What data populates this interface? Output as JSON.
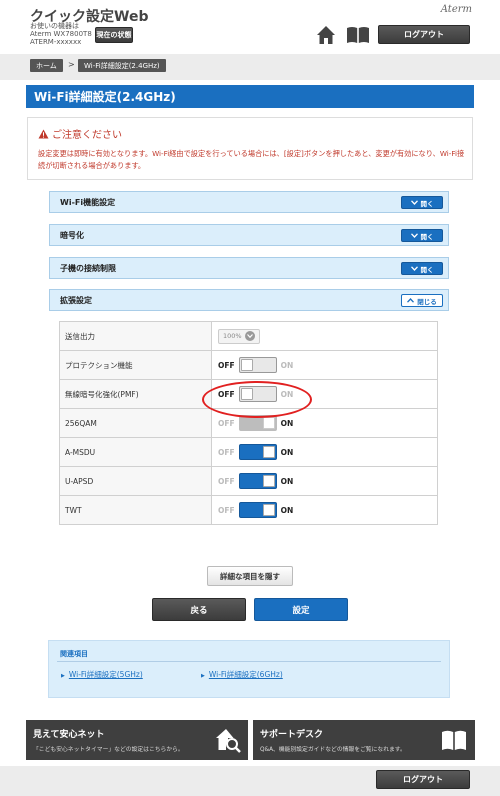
{
  "header": {
    "app_title": "クイック設定Web",
    "device_label": "お使いの機器は",
    "device_model": "Aterm WX7800T8",
    "device_id": "ATERM-xxxxxx",
    "status_button": "現在の状態",
    "brand": "Aterm",
    "logout": "ログアウト"
  },
  "breadcrumb": {
    "home": "ホーム",
    "separator": ">",
    "current": "Wi-Fi詳細設定(2.4GHz)"
  },
  "page_title": "Wi-Fi詳細設定(2.4GHz)",
  "caution": {
    "heading": "ご注意ください",
    "text": "設定変更は即時に有効となります。Wi-Fi経由で設定を行っている場合には、[設定]ボタンを押したあと、変更が有効になり、Wi-Fi接続が切断される場合があります。"
  },
  "sections": [
    {
      "label": "Wi-Fi機能設定",
      "button": "開く",
      "state": "collapsed"
    },
    {
      "label": "暗号化",
      "button": "開く",
      "state": "collapsed"
    },
    {
      "label": "子機の接続制限",
      "button": "開く",
      "state": "collapsed"
    },
    {
      "label": "拡張設定",
      "button": "閉じる",
      "state": "expanded"
    }
  ],
  "settings": {
    "tx_power": {
      "label": "送信出力",
      "value": "100%"
    },
    "protection": {
      "label": "プロテクション機能",
      "off": "OFF",
      "on": "ON",
      "state": "off"
    },
    "pmf": {
      "label": "無線暗号化強化(PMF)",
      "off": "OFF",
      "on": "ON",
      "state": "off"
    },
    "qam256": {
      "label": "256QAM",
      "off": "OFF",
      "on": "ON",
      "state": "on-disabled"
    },
    "amsdu": {
      "label": "A-MSDU",
      "off": "OFF",
      "on": "ON",
      "state": "on"
    },
    "uapsd": {
      "label": "U-APSD",
      "off": "OFF",
      "on": "ON",
      "state": "on"
    },
    "twt": {
      "label": "TWT",
      "off": "OFF",
      "on": "ON",
      "state": "on"
    }
  },
  "buttons": {
    "hide_details": "詳細な項目を隠す",
    "back": "戻る",
    "apply": "設定"
  },
  "related": {
    "heading": "関連項目",
    "links": [
      "Wi-Fi詳細設定(5GHz)",
      "Wi-Fi詳細設定(6GHz)"
    ]
  },
  "banners": {
    "anshin": {
      "title": "見えて安心ネット",
      "sub": "「こども安心ネットタイマー」などの設定はこちらから。"
    },
    "support": {
      "title": "サポートデスク",
      "sub": "Q&A、機能別設定ガイドなどの情報をご覧になれます。"
    }
  },
  "footer": {
    "logout": "ログアウト"
  },
  "colors": {
    "accent": "#1a6fc0",
    "section_bg": "#dbeefb",
    "caution": "#c0392b",
    "highlight": "#e12020"
  }
}
